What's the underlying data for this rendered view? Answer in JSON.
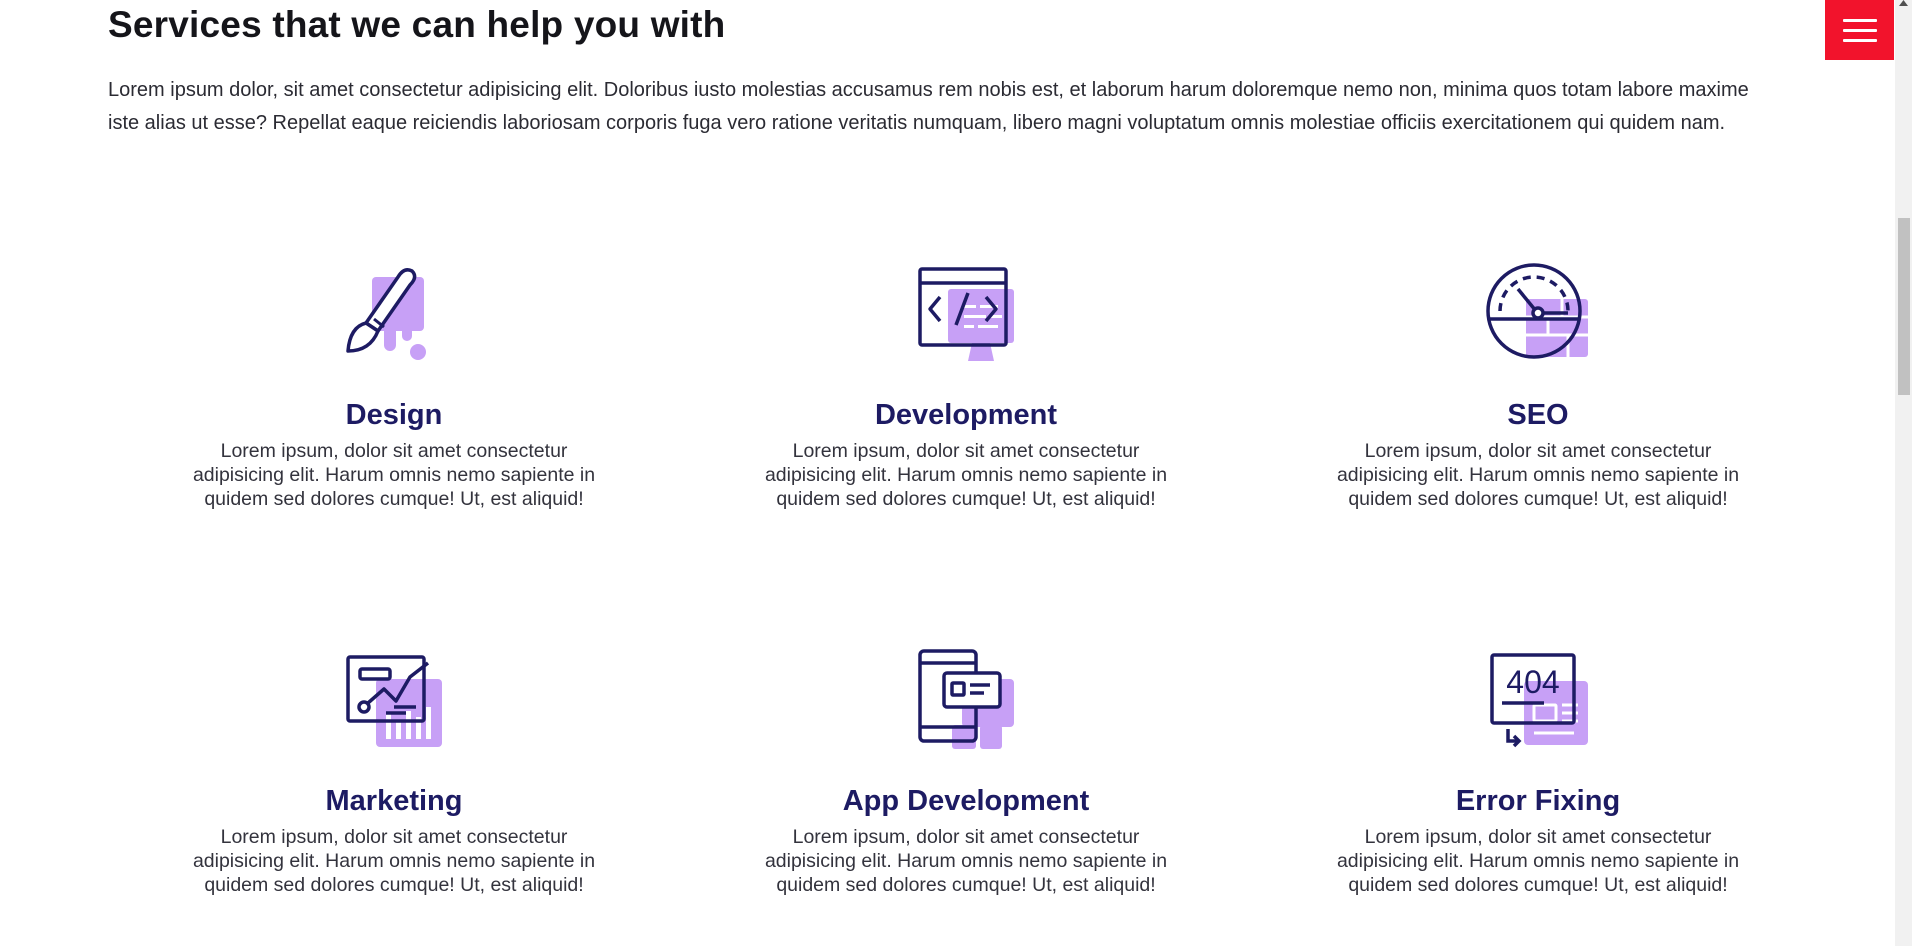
{
  "section": {
    "title": "Services that we can help you with",
    "intro": "Lorem ipsum dolor, sit amet consectetur adipisicing elit. Doloribus iusto molestias accusamus rem nobis est, et laborum harum doloremque nemo non, minima quos totam labore maxime iste alias ut esse? Repellat eaque reiciendis laboriosam corporis fuga vero ratione veritatis numquam, libero magni voluptatum omnis molestiae officiis exercitationem qui quidem nam."
  },
  "services": [
    {
      "title": "Design",
      "icon": "paint-brush-icon",
      "description": "Lorem ipsum, dolor sit amet consectetur adipisicing elit. Harum omnis nemo sapiente in quidem sed dolores cumque! Ut, est aliquid!"
    },
    {
      "title": "Development",
      "icon": "code-window-icon",
      "description": "Lorem ipsum, dolor sit amet consectetur adipisicing elit. Harum omnis nemo sapiente in quidem sed dolores cumque! Ut, est aliquid!"
    },
    {
      "title": "SEO",
      "icon": "speed-gauge-icon",
      "description": "Lorem ipsum, dolor sit amet consectetur adipisicing elit. Harum omnis nemo sapiente in quidem sed dolores cumque! Ut, est aliquid!"
    },
    {
      "title": "Marketing",
      "icon": "analytics-chart-icon",
      "description": "Lorem ipsum, dolor sit amet consectetur adipisicing elit. Harum omnis nemo sapiente in quidem sed dolores cumque! Ut, est aliquid!"
    },
    {
      "title": "App Development",
      "icon": "mobile-app-icon",
      "description": "Lorem ipsum, dolor sit amet consectetur adipisicing elit. Harum omnis nemo sapiente in quidem sed dolores cumque! Ut, est aliquid!"
    },
    {
      "title": "Error Fixing",
      "icon": "error-404-icon",
      "icon_text": "404",
      "description": "Lorem ipsum, dolor sit amet consectetur adipisicing elit. Harum omnis nemo sapiente in quidem sed dolores cumque! Ut, est aliquid!"
    }
  ],
  "menu": {
    "icon": "hamburger-menu-icon"
  },
  "colors": {
    "accent": "#f2132c",
    "heading": "#1d1b63",
    "icon_outline": "#1d1b63",
    "icon_fill": "#c7a0f6",
    "text": "#33333d"
  }
}
